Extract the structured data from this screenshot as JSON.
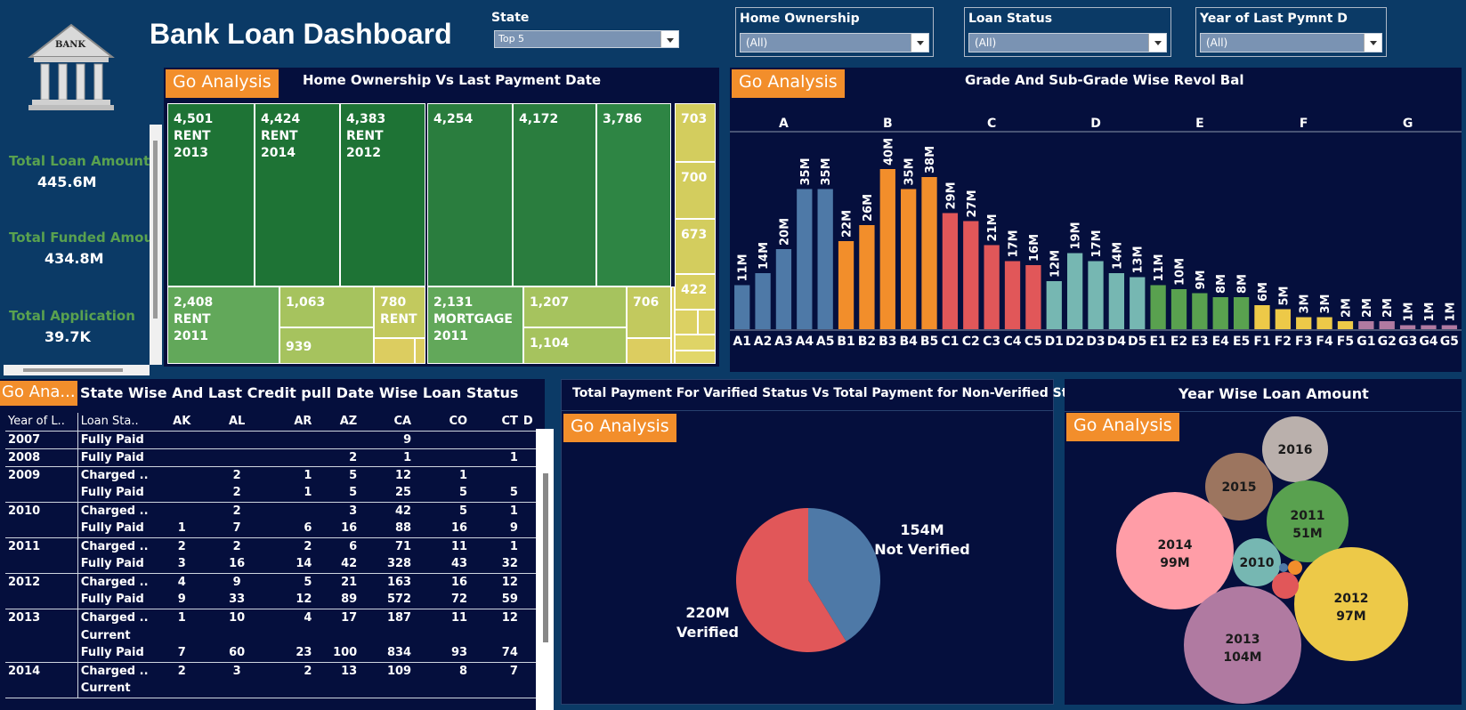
{
  "header": {
    "title": "Bank Loan Dashboard",
    "logo_text": "BANK"
  },
  "filters": [
    {
      "label": "State",
      "value": "Top 5"
    },
    {
      "label": "Home Ownership",
      "value": "(All)"
    },
    {
      "label": "Loan Status",
      "value": "(All)"
    },
    {
      "label": "Year of Last Pymnt D",
      "value": "(All)"
    }
  ],
  "kpis": [
    {
      "label": "Total Loan Amount",
      "value": "445.6M"
    },
    {
      "label": "Total Funded Amount",
      "value": "434.8M"
    },
    {
      "label": "Total Application",
      "value": "39.7K"
    }
  ],
  "go_label": "Go Analysis",
  "go_label_short": "Go Ana...",
  "treemap": {
    "title": "Home Ownership Vs Last Payment Date",
    "cells": [
      {
        "label": "4,501\nRENT\n2013",
        "value": 4501,
        "color": "#1e7335"
      },
      {
        "label": "4,424\nRENT\n2014",
        "value": 4424,
        "color": "#1e7335"
      },
      {
        "label": "4,383\nRENT\n2012",
        "value": 4383,
        "color": "#1e7335"
      },
      {
        "label": "2,408\nRENT\n2011",
        "value": 2408,
        "color": "#62a85a"
      },
      {
        "label": "1,063",
        "value": 1063,
        "color": "#a6c35e"
      },
      {
        "label": "939",
        "value": 939,
        "color": "#a6c35e"
      },
      {
        "label": "780\nRENT",
        "value": 780,
        "color": "#c2c95e"
      },
      {
        "label": "4,254",
        "value": 4254,
        "color": "#2a7d3e"
      },
      {
        "label": "4,172",
        "value": 4172,
        "color": "#2a7d3e"
      },
      {
        "label": "3,786",
        "value": 3786,
        "color": "#2e8544"
      },
      {
        "label": "2,131\nMORTGAGE\n2011",
        "value": 2131,
        "color": "#62a85a"
      },
      {
        "label": "1,207",
        "value": 1207,
        "color": "#a6c35e"
      },
      {
        "label": "1,104",
        "value": 1104,
        "color": "#a6c35e"
      },
      {
        "label": "706",
        "value": 706,
        "color": "#c2c95e"
      },
      {
        "label": "703",
        "value": 703,
        "color": "#d3cd5e"
      },
      {
        "label": "700",
        "value": 700,
        "color": "#d3cd5e"
      },
      {
        "label": "673",
        "value": 673,
        "color": "#d3cd5e"
      },
      {
        "label": "422",
        "value": 422,
        "color": "#d8cf60"
      }
    ]
  },
  "grade_chart": {
    "title": "Grade And Sub-Grade Wise Revol Bal"
  },
  "crosstab": {
    "title": "State Wise And Last Credit pull Date Wise Loan Status",
    "headers": [
      "Year of L..",
      "Loan Sta..",
      "AK",
      "AL",
      "AR",
      "AZ",
      "CA",
      "CO",
      "CT",
      "D"
    ],
    "rows": [
      [
        "2007",
        "Fully Paid",
        "",
        "",
        "",
        "",
        "9",
        "",
        ""
      ],
      [
        "2008",
        "Fully Paid",
        "",
        "",
        "",
        "2",
        "1",
        "",
        "1"
      ],
      [
        "2009",
        "Charged ..",
        "",
        "2",
        "1",
        "5",
        "12",
        "1",
        ""
      ],
      [
        "",
        "Fully Paid",
        "",
        "2",
        "1",
        "5",
        "25",
        "5",
        "5"
      ],
      [
        "2010",
        "Charged ..",
        "",
        "2",
        "",
        "3",
        "42",
        "5",
        "1"
      ],
      [
        "",
        "Fully Paid",
        "1",
        "7",
        "6",
        "16",
        "88",
        "16",
        "9"
      ],
      [
        "2011",
        "Charged ..",
        "2",
        "2",
        "2",
        "6",
        "71",
        "11",
        "1"
      ],
      [
        "",
        "Fully Paid",
        "3",
        "16",
        "14",
        "42",
        "328",
        "43",
        "32"
      ],
      [
        "2012",
        "Charged ..",
        "4",
        "9",
        "5",
        "21",
        "163",
        "16",
        "12"
      ],
      [
        "",
        "Fully Paid",
        "9",
        "33",
        "12",
        "89",
        "572",
        "72",
        "59"
      ],
      [
        "2013",
        "Charged ..",
        "1",
        "10",
        "4",
        "17",
        "187",
        "11",
        "12"
      ],
      [
        "",
        "Current",
        "",
        "",
        "",
        "",
        "",
        "",
        ""
      ],
      [
        "",
        "Fully Paid",
        "7",
        "60",
        "23",
        "100",
        "834",
        "93",
        "74"
      ],
      [
        "2014",
        "Charged ..",
        "2",
        "3",
        "2",
        "13",
        "109",
        "8",
        "7"
      ],
      [
        "",
        "Current",
        "",
        "",
        "",
        "",
        "",
        "",
        ""
      ]
    ]
  },
  "pie": {
    "title": "Total Payment For Varified Status Vs Total Payment for Non-Verified Status"
  },
  "bubble": {
    "title": "Year Wise Loan Amount"
  },
  "chart_data": [
    {
      "type": "bar",
      "title": "Grade And Sub-Grade Wise Revol Bal",
      "groups": [
        "A",
        "B",
        "C",
        "D",
        "E",
        "F",
        "G"
      ],
      "group_colors": {
        "A": "#4e79a7",
        "B": "#f28e2b",
        "C": "#e15759",
        "D": "#76b7b2",
        "E": "#59a14f",
        "F": "#edc948",
        "G": "#b07aa1"
      },
      "categories": [
        "A1",
        "A2",
        "A3",
        "A4",
        "A5",
        "B1",
        "B2",
        "B3",
        "B4",
        "B5",
        "C1",
        "C2",
        "C3",
        "C4",
        "C5",
        "D1",
        "D2",
        "D3",
        "D4",
        "D5",
        "E1",
        "E2",
        "E3",
        "E4",
        "E5",
        "F1",
        "F2",
        "F3",
        "F4",
        "F5",
        "G1",
        "G2",
        "G3",
        "G4",
        "G5"
      ],
      "values": [
        11,
        14,
        20,
        35,
        35,
        22,
        26,
        40,
        35,
        38,
        29,
        27,
        21,
        17,
        16,
        12,
        19,
        17,
        14,
        13,
        11,
        10,
        9,
        8,
        8,
        6,
        5,
        3,
        3,
        2,
        2,
        2,
        1,
        1,
        1
      ],
      "value_labels": [
        "11M",
        "14M",
        "20M",
        "35M",
        "35M",
        "22M",
        "26M",
        "40M",
        "35M",
        "38M",
        "29M",
        "27M",
        "21M",
        "17M",
        "16M",
        "12M",
        "19M",
        "17M",
        "14M",
        "13M",
        "11M",
        "10M",
        "9M",
        "8M",
        "8M",
        "6M",
        "5M",
        "3M",
        "3M",
        "2M",
        "2M",
        "2M",
        "1M",
        "1M",
        "1M"
      ],
      "unit": "M"
    },
    {
      "type": "pie",
      "title": "Total Payment For Varified Status Vs Total Payment for Non-Verified Status",
      "slices": [
        {
          "name": "Not Verified",
          "value": 154,
          "label": "154M",
          "color": "#4e79a7"
        },
        {
          "name": "Verified",
          "value": 220,
          "label": "220M",
          "color": "#e15759"
        }
      ]
    },
    {
      "type": "bubble",
      "title": "Year Wise Loan Amount",
      "bubbles": [
        {
          "year": "2016",
          "label": "",
          "color": "#bab0ac"
        },
        {
          "year": "2015",
          "label": "",
          "color": "#9c755f"
        },
        {
          "year": "2011",
          "label": "51M",
          "color": "#59a14f"
        },
        {
          "year": "2014",
          "label": "99M",
          "color": "#ff9da7"
        },
        {
          "year": "2010",
          "label": "",
          "color": "#76b7b2"
        },
        {
          "year": "2012",
          "label": "97M",
          "color": "#edc948"
        },
        {
          "year": "2013",
          "label": "104M",
          "color": "#b07aa1"
        },
        {
          "year": "",
          "label": "",
          "color": "#e15759"
        },
        {
          "year": "",
          "label": "",
          "color": "#f28e2b"
        },
        {
          "year": "",
          "label": "",
          "color": "#4e79a7"
        }
      ]
    }
  ]
}
